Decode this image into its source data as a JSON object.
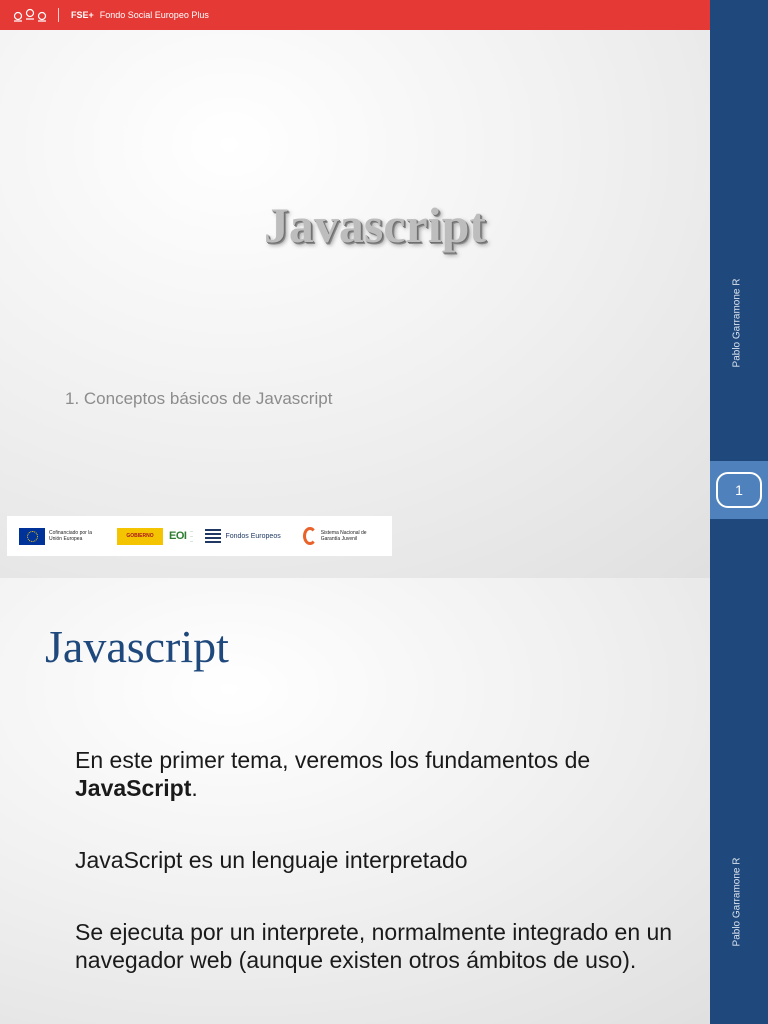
{
  "fse_bar": {
    "short": "FSE+",
    "long": "Fondo Social Europeo Plus"
  },
  "slide1": {
    "title": "Javascript",
    "subtitle": "1. Conceptos básicos de Javascript",
    "author": "Pablo Garramone R",
    "page_number": "1",
    "logos": {
      "eu": "Cofinanciado por la Unión Europea",
      "eoi": "EOI",
      "fondos": "Fondos Europeos",
      "garantia": "Sistema Nacional de Garantía Juvenil"
    }
  },
  "slide2": {
    "title": "Javascript",
    "author": "Pablo Garramone R",
    "p1_before": "En este primer tema, veremos los fundamentos de ",
    "p1_bold": "JavaScript",
    "p1_after": ".",
    "p2": "JavaScript es un lenguaje interpretado",
    "p3": "Se ejecuta por un interprete, normalmente integrado en un navegador web (aunque existen otros ámbitos de uso)."
  },
  "colors": {
    "accent_blue": "#1f497d",
    "page_num_blue": "#4f81bd",
    "fse_red": "#e53935"
  }
}
